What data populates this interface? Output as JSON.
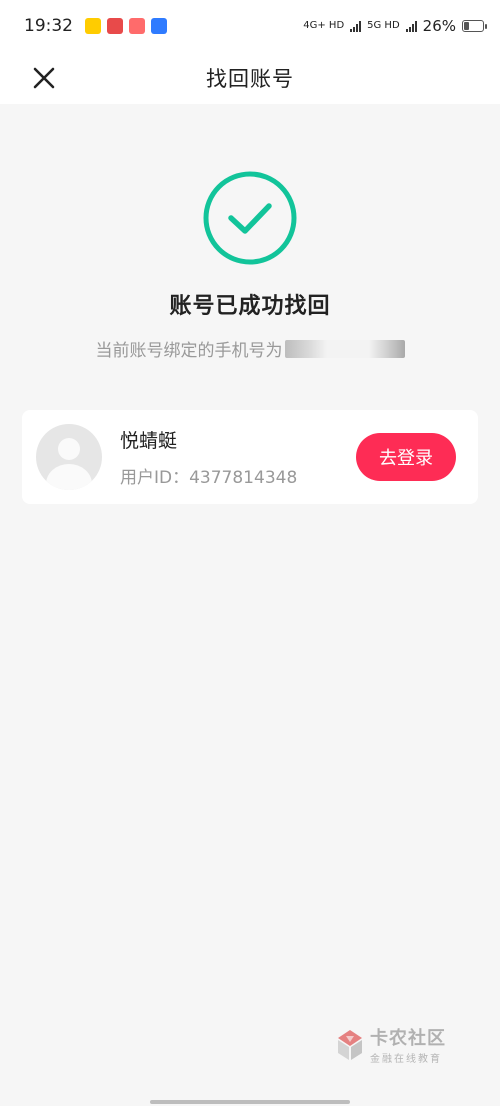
{
  "status_bar": {
    "time": "19:32",
    "net1": "4G+ HD",
    "net2": "5G HD",
    "battery": "26%",
    "battery_level": 0.26,
    "notification_icons": [
      "app-icon-yellow",
      "app-icon-red",
      "app-icon-red2",
      "app-icon-blue"
    ]
  },
  "header": {
    "title": "找回账号",
    "close_icon": "close-icon"
  },
  "success": {
    "icon": "check-circle-icon",
    "title": "账号已成功找回",
    "subtitle": "当前账号绑定的手机号为"
  },
  "account": {
    "nickname": "悦蜻蜓",
    "user_id": "用户ID：4377814348",
    "login_label": "去登录"
  },
  "watermark": {
    "main": "卡农社区",
    "sub": "金融在线教育"
  },
  "colors": {
    "accent_green": "#12c49a",
    "login_red": "#fe2c55",
    "background": "#f6f6f6"
  }
}
